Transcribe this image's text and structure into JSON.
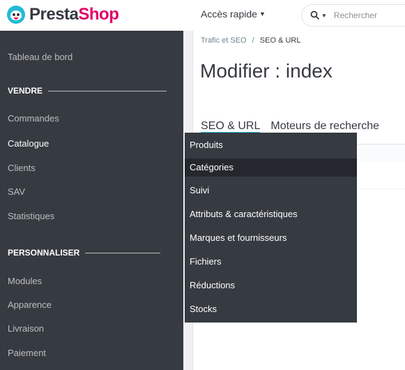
{
  "header": {
    "logo_part1": "Presta",
    "logo_part2": "Shop",
    "quick_access": "Accès rapide",
    "search_placeholder": "Rechercher"
  },
  "breadcrumb": {
    "parent": "Trafic et SEO",
    "separator": "/",
    "current": "SEO & URL"
  },
  "page_title": "Modifier : index",
  "tabs": [
    {
      "label": "SEO & URL"
    },
    {
      "label": "Moteurs de recherche"
    }
  ],
  "sidebar": {
    "dashboard": "Tableau de bord",
    "sections": [
      {
        "title": "VENDRE",
        "items": [
          "Commandes",
          "Catalogue",
          "Clients",
          "SAV",
          "Statistiques"
        ]
      },
      {
        "title": "PERSONNALISER",
        "items": [
          "Modules",
          "Apparence",
          "Livraison",
          "Paiement"
        ]
      }
    ],
    "active_item": "Catalogue"
  },
  "submenu": {
    "items": [
      "Produits",
      "Catégories",
      "Suivi",
      "Attributs & caractéristiques",
      "Marques et fournisseurs",
      "Fichiers",
      "Réductions",
      "Stocks"
    ],
    "highlighted": "Catégories"
  },
  "colors": {
    "sidebar_bg": "#363a41",
    "submenu_highlight": "#24282e",
    "brand_pink": "#df0067",
    "brand_blue": "#25b9d7"
  }
}
